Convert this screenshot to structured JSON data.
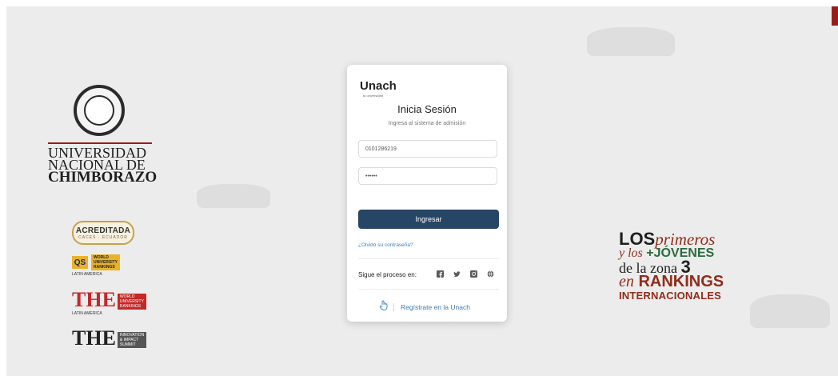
{
  "branding": {
    "university_name_lines": [
      "UNIVERSIDAD",
      "NACIONAL DE",
      "CHIMBORAZO"
    ],
    "badges": {
      "acreditada": {
        "title": "ACREDITADA",
        "subtitle": "CACES · ECUADOR"
      },
      "qs": {
        "mark": "QS",
        "lines": [
          "WORLD",
          "UNIVERSITY",
          "RANKINGS"
        ],
        "caption": "LATIN AMERICA"
      },
      "the_latam": {
        "mark": "THE",
        "lines": [
          "WORLD",
          "UNIVERSITY",
          "RANKINGS"
        ],
        "caption": "LATIN AMERICA"
      },
      "the_impact": {
        "mark": "THE",
        "lines": [
          "INNOVATION",
          "& IMPACT",
          "SUMMIT"
        ]
      }
    }
  },
  "slogan": {
    "line1_bold": "LOS",
    "line1_italic": "primeros",
    "line2_italic": "y los",
    "line2_bold": "+JÓVENES",
    "line3_text": "de la zona",
    "line3_number": "3",
    "line4_italic": "en",
    "line4_bold": "RANKINGS",
    "line5": "INTERNACIONALES"
  },
  "login": {
    "logo": "Unach",
    "logo_tagline": "tu universidad",
    "title": "Inicia Sesión",
    "subtitle": "Ingresa al sistema de admisión",
    "username_value": "0101286219",
    "password_value": "••••••",
    "submit_label": "Ingresar",
    "forgot_label": "¿Olvidó su contraseña?",
    "follow_label": "Sigue el proceso en:",
    "social_icons": [
      "facebook-icon",
      "twitter-icon",
      "instagram-icon",
      "web-icon"
    ],
    "register_label": "Regístrate en la Unach"
  },
  "colors": {
    "primary_button": "#274564",
    "link": "#3b7fb6",
    "brand_red": "#9b1b1b",
    "background": "#ececec"
  }
}
